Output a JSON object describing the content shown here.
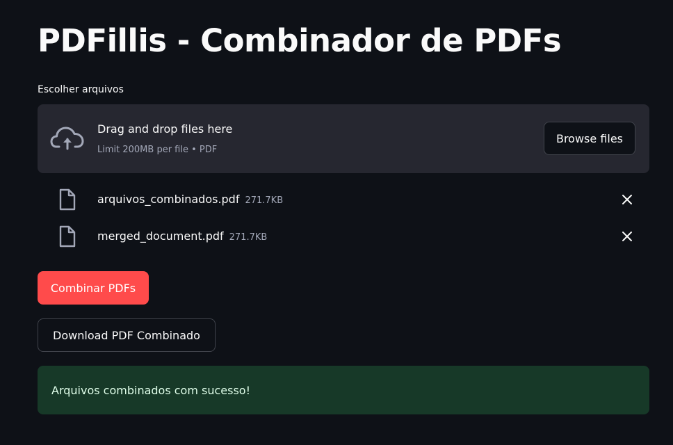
{
  "app": {
    "title": "PDFillis - Combinador de PDFs"
  },
  "uploader": {
    "label": "Escolher arquivos",
    "instructions": "Drag and drop files here",
    "limit": "Limit 200MB per file • PDF",
    "browse_label": "Browse files",
    "icon": "cloud-upload-icon"
  },
  "files": [
    {
      "name": "arquivos_combinados.pdf",
      "size": "271.7KB"
    },
    {
      "name": "merged_document.pdf",
      "size": "271.7KB"
    }
  ],
  "actions": {
    "combine_label": "Combinar PDFs",
    "download_label": "Download PDF Combinado"
  },
  "alert": {
    "message": "Arquivos combinados com sucesso!"
  },
  "colors": {
    "background": "#0e1117",
    "dropzone": "#262730",
    "primary": "#ff4b4b",
    "success_bg": "#173928",
    "success_text": "#dffde9"
  }
}
